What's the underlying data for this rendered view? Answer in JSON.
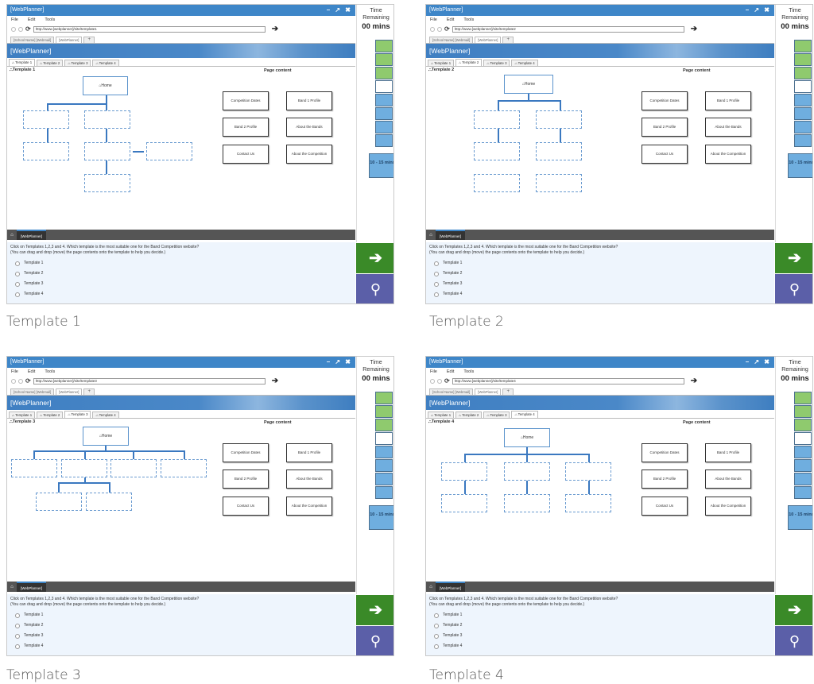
{
  "window_title": "[WebPlanner]",
  "window_controls": "– ↗ ✖",
  "menu": [
    "File",
    "Edit",
    "Tools"
  ],
  "browser_tabs": [
    "[School Name] [Webmail]",
    "[WebPlanner]",
    "+"
  ],
  "banner_title": "[WebPlanner]",
  "page_tabs": [
    "Template 1",
    "Template 2",
    "Template 3",
    "Template 4"
  ],
  "page_content_title": "Page content",
  "home_label": "Home",
  "page_content": [
    "Competition Dates",
    "Band 1 Profile",
    "Band 2 Profile",
    "About the Bands",
    "Contact Us",
    "About the Competition"
  ],
  "taskbar_label": "[WebPlanner]",
  "question_line1": "Click on Templates 1,2,3 and 4. Which template is the most suitable one for the Band Competition website?",
  "question_line2": "(You can drag and drop (move) the page contents onto the template to help you decide.)",
  "options": [
    "Template 1",
    "Template 2",
    "Template 3",
    "Template 4"
  ],
  "timer": {
    "label_line1": "Time",
    "label_line2": "Remaining",
    "value": "00 mins",
    "band": "10 - 15 mins",
    "cells": [
      "g",
      "g",
      "g",
      "w",
      "b",
      "b",
      "b",
      "b"
    ]
  },
  "colors": {
    "title_bar": "#3e86c8",
    "next_button": "#3a8a28",
    "search_button": "#5b5fa8",
    "timer_green": "#8fca6e",
    "timer_blue": "#6faedf"
  },
  "panels": [
    {
      "caption": "Template 1",
      "template_title": "Template 1",
      "url": "http://www.[webplanner]/site/template1",
      "active_tab": 0
    },
    {
      "caption": "Template 2",
      "template_title": "Template 2",
      "url": "http://www.[webplanner]/site/template2",
      "active_tab": 1
    },
    {
      "caption": "Template 3",
      "template_title": "Template 3",
      "url": "http://www.[webplanner]/site/template3",
      "active_tab": 2
    },
    {
      "caption": "Template 4",
      "template_title": "Template 4",
      "url": "http://www.[webplanner]/site/template4",
      "active_tab": 3
    }
  ]
}
